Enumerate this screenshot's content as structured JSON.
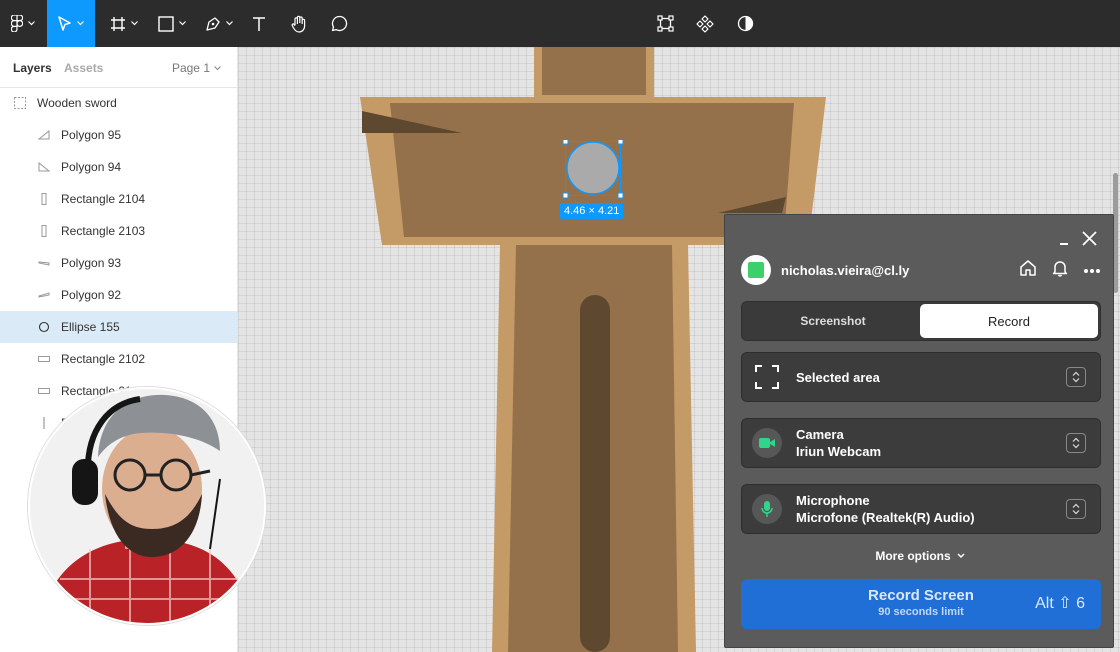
{
  "toolbar": {
    "tools": [
      "figma-menu",
      "move",
      "frame",
      "rectangle",
      "pen",
      "text",
      "hand",
      "comment"
    ],
    "right_tools": [
      "transform",
      "component",
      "contrast"
    ],
    "active": "move"
  },
  "left_panel": {
    "tabs": {
      "layers": "Layers",
      "assets": "Assets",
      "page": "Page 1"
    },
    "root_layer": "Wooden sword",
    "layers": [
      {
        "name": "Polygon 95",
        "icon": "triangle-icon"
      },
      {
        "name": "Polygon 94",
        "icon": "triangle-icon"
      },
      {
        "name": "Rectangle 2104",
        "icon": "rectangle-vertical-icon"
      },
      {
        "name": "Rectangle 2103",
        "icon": "rectangle-vertical-icon"
      },
      {
        "name": "Polygon 93",
        "icon": "polygon-flat-icon"
      },
      {
        "name": "Polygon 92",
        "icon": "polygon-flat-icon"
      },
      {
        "name": "Ellipse 155",
        "icon": "ellipse-icon",
        "selected": true
      },
      {
        "name": "Rectangle 2102",
        "icon": "rectangle-icon"
      },
      {
        "name": "Rectangle 21…",
        "icon": "rectangle-icon"
      },
      {
        "name": "R…",
        "icon": "line-icon"
      }
    ]
  },
  "canvas": {
    "selection_size": "4.46 × 4.21"
  },
  "recorder": {
    "user": "nicholas.vieira@cl.ly",
    "modes": {
      "screenshot": "Screenshot",
      "record": "Record"
    },
    "active_mode": "Record",
    "area": {
      "label": "Selected area"
    },
    "camera": {
      "title": "Camera",
      "device": "Iriun Webcam"
    },
    "microphone": {
      "title": "Microphone",
      "device": "Microfone (Realtek(R) Audio)"
    },
    "more_options": "More options",
    "record_button": {
      "label": "Record Screen",
      "sublabel": "90 seconds limit",
      "hotkey": "Alt ⇧ 6"
    },
    "accent_color": "#1f6fd6"
  }
}
